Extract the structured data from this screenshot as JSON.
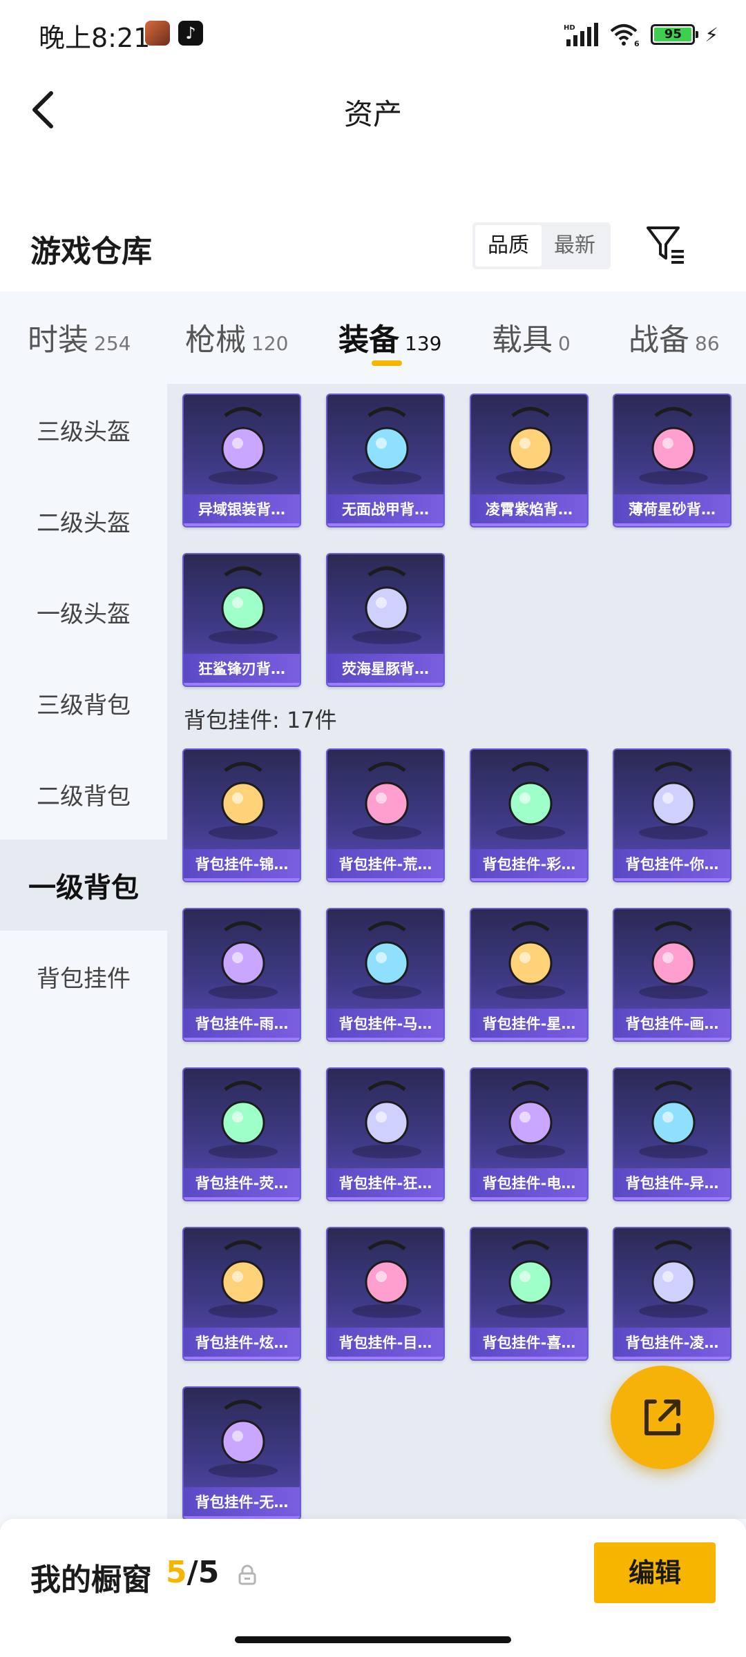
{
  "status_bar": {
    "time": "晚上8:21",
    "network": "HD",
    "wifi_generation": "6",
    "battery": "95"
  },
  "header": {
    "title": "资产"
  },
  "warehouse": {
    "title": "游戏仓库",
    "sort_options": [
      "品质",
      "最新"
    ],
    "active_sort": "品质"
  },
  "tabs": [
    {
      "label": "时装",
      "count": "254"
    },
    {
      "label": "枪械",
      "count": "120"
    },
    {
      "label": "装备",
      "count": "139"
    },
    {
      "label": "载具",
      "count": "0"
    },
    {
      "label": "战备",
      "count": "86"
    }
  ],
  "active_tab": "装备",
  "sidebar": [
    {
      "label": "三级头盔"
    },
    {
      "label": "二级头盔"
    },
    {
      "label": "一级头盔"
    },
    {
      "label": "三级背包"
    },
    {
      "label": "二级背包"
    },
    {
      "label": "一级背包"
    },
    {
      "label": "背包挂件"
    }
  ],
  "active_sidebar": "一级背包",
  "backpacks": [
    {
      "name": "异域银装背…",
      "icon": "black-silver-backpack-icon"
    },
    {
      "name": "无面战甲背…",
      "icon": "faceless-armor-backpack-icon"
    },
    {
      "name": "凌霄紫焰背…",
      "icon": "purple-flame-backpack-icon"
    },
    {
      "name": "薄荷星砂背…",
      "icon": "mint-star-backpack-icon"
    },
    {
      "name": "狂鲨锋刃背…",
      "icon": "shark-backpack-icon"
    },
    {
      "name": "荧海星豚背…",
      "icon": "dolphin-backpack-icon"
    }
  ],
  "charms_section": {
    "title": "背包挂件: 17件"
  },
  "charms": [
    {
      "name": "背包挂件-锦…",
      "icon": "feather-staff-charm-icon"
    },
    {
      "name": "背包挂件-荒…",
      "icon": "sun-charm-icon"
    },
    {
      "name": "背包挂件-彩…",
      "icon": "ice-cream-charm-icon"
    },
    {
      "name": "背包挂件-你…",
      "icon": "penguin-charm-icon"
    },
    {
      "name": "背包挂件-雨…",
      "icon": "wand-charm-icon"
    },
    {
      "name": "背包挂件-马…",
      "icon": "horse-charm-icon"
    },
    {
      "name": "背包挂件-星…",
      "icon": "planet-charm-icon"
    },
    {
      "name": "背包挂件-画…",
      "icon": "scroll-charm-icon"
    },
    {
      "name": "背包挂件-荧…",
      "icon": "handheld-console-charm-icon"
    },
    {
      "name": "背包挂件-狂…",
      "icon": "fin-charm-icon"
    },
    {
      "name": "背包挂件-电…",
      "icon": "arcade-machine-charm-icon"
    },
    {
      "name": "背包挂件-异…",
      "icon": "winged-emblem-charm-icon"
    },
    {
      "name": "背包挂件-炫…",
      "icon": "candy-charm-icon"
    },
    {
      "name": "背包挂件-目…",
      "icon": "swirl-charm-icon"
    },
    {
      "name": "背包挂件-喜…",
      "icon": "bow-charm-icon"
    },
    {
      "name": "背包挂件-凌…",
      "icon": "crescent-charm-icon"
    },
    {
      "name": "背包挂件-无…",
      "icon": "crystal-charm-icon"
    }
  ],
  "showcase": {
    "title": "我的橱窗",
    "current": "5",
    "separator": "/",
    "max": "5",
    "edit_label": "编辑"
  },
  "colors": {
    "accent": "#f7b500",
    "card_bg": "#3e3a86",
    "card_label": "#6a52d6"
  }
}
